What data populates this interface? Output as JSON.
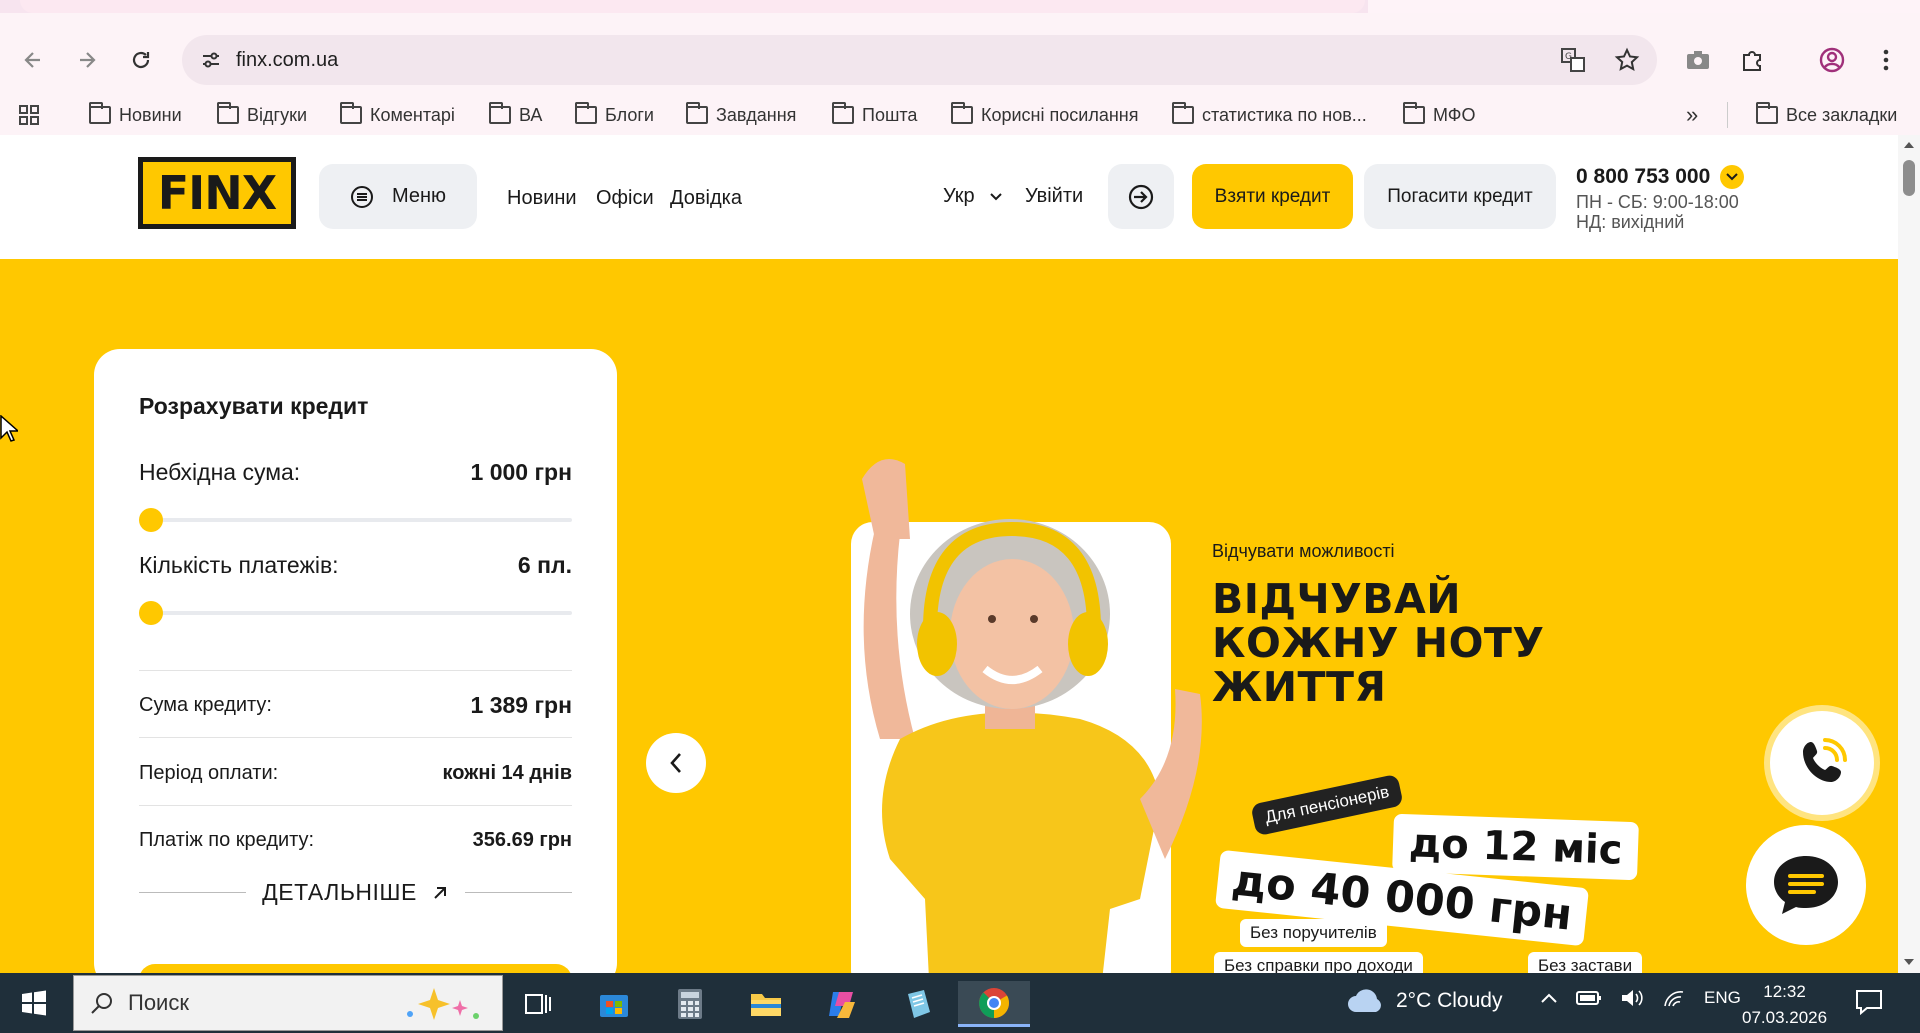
{
  "browser": {
    "url": "finx.com.ua",
    "bookmarks": [
      "Новини",
      "Відгуки",
      "Коментарі",
      "ВА",
      "Блоги",
      "Завдання",
      "Пошта",
      "Корисні посилання",
      "статистика по нов...",
      "МФО"
    ],
    "all_bookmarks": "Все закладки",
    "more": "»"
  },
  "header": {
    "logo": "FINX",
    "menu_label": "Меню",
    "nav": [
      "Новини",
      "Офіси",
      "Довідка"
    ],
    "lang": "Укр",
    "login": "Увійти",
    "take_credit": "Взяти кредит",
    "pay_credit": "Погасити кредит",
    "phone": "0 800 753 000",
    "hours_weekday": "ПН - СБ: 9:00-18:00",
    "hours_sunday": "НД: вихідний"
  },
  "calculator": {
    "title": "Розрахувати кредит",
    "amount_label": "Небхідна сума:",
    "amount_value": "1 000 грн",
    "amount_fraction": 0.0,
    "payments_label": "Кількість платежів:",
    "payments_value": "6 пл.",
    "payments_fraction": 0.0,
    "credit_sum_label": "Сума кредиту:",
    "credit_sum_value": "1 389 грн",
    "period_label": "Період оплати:",
    "period_value": "кожні 14 днів",
    "payment_label": "Платіж по кредиту:",
    "payment_value": "356.69 грн",
    "more_label": "ДЕТАЛЬНІШЕ"
  },
  "banner": {
    "subtitle": "Відчувати можливості",
    "headline": [
      "ВІДЧУВАЙ",
      "КОЖНУ НОТУ",
      "ЖИТТЯ"
    ],
    "tag_pensioners": "Для пенсіонерів",
    "tag_term": "до 12 міс",
    "tag_amount": "до 40 000 грн",
    "tag_no_guarantors": "Без поручителів",
    "tag_no_income": "Без справки про доходи",
    "tag_no_collateral": "Без застави"
  },
  "taskbar": {
    "search_placeholder": "Поиск",
    "weather": "2°C  Cloudy",
    "lang": "ENG",
    "time": "12:32",
    "date": "07.03.2026"
  },
  "colors": {
    "brand_yellow": "#ffc800",
    "dark": "#1a1a1a",
    "taskbar": "#1f2f3a"
  }
}
